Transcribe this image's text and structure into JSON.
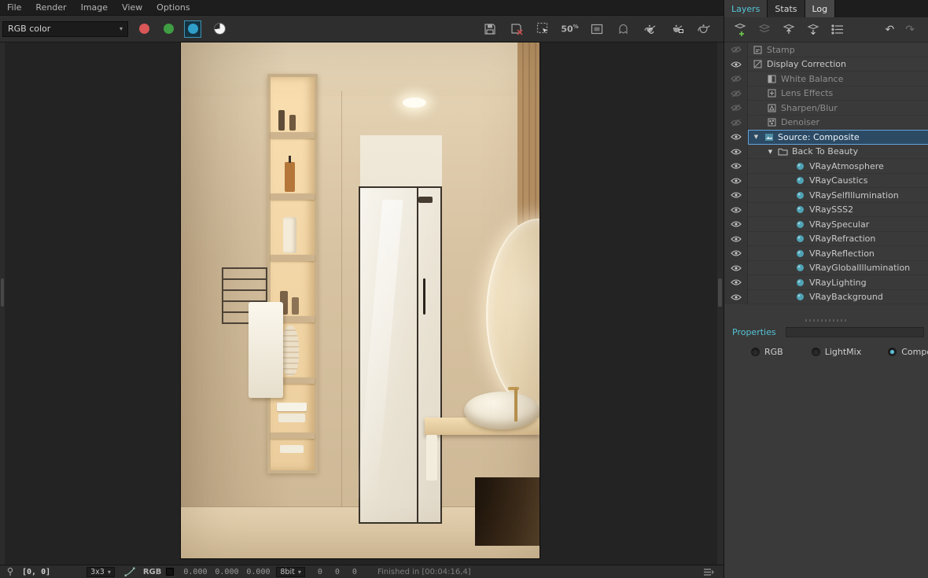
{
  "colors": {
    "accent": "#56c5d8",
    "selection": "#68a5da",
    "red_channel": "#d95757",
    "green_channel": "#43a047",
    "blue_channel": "#2f9fc9"
  },
  "glyphs": {
    "caret": "▾",
    "expand": "▼",
    "undo": "↶",
    "redo": "↷"
  },
  "menubar": {
    "items": [
      "File",
      "Render",
      "Image",
      "View",
      "Options"
    ]
  },
  "toolbar": {
    "channel_dropdown": "RGB color",
    "zoom_label": "50",
    "zoom_pct": "%"
  },
  "panel": {
    "tabs": [
      {
        "label": "Layers"
      },
      {
        "label": "Stats"
      },
      {
        "label": "Log"
      }
    ],
    "layers": [
      {
        "label": "Stamp"
      },
      {
        "label": "Display Correction"
      },
      {
        "label": "White Balance"
      },
      {
        "label": "Lens Effects"
      },
      {
        "label": "Sharpen/Blur"
      },
      {
        "label": "Denoiser"
      },
      {
        "label": "Source: Composite"
      },
      {
        "label": "Back To Beauty"
      },
      {
        "label": "VRayAtmosphere"
      },
      {
        "label": "VRayCaustics"
      },
      {
        "label": "VRaySelfIllumination"
      },
      {
        "label": "VRaySSS2"
      },
      {
        "label": "VRaySpecular"
      },
      {
        "label": "VRayRefraction"
      },
      {
        "label": "VRayReflection"
      },
      {
        "label": "VRayGlobalIllumination"
      },
      {
        "label": "VRayLighting"
      },
      {
        "label": "VRayBackground"
      }
    ],
    "properties": {
      "title": "Properties",
      "options": [
        {
          "label": "RGB"
        },
        {
          "label": "LightMix"
        },
        {
          "label": "Composite"
        }
      ],
      "selected": "Composite"
    }
  },
  "statusbar": {
    "coords": "[0, 0]",
    "kernel": "3x3",
    "channel": "RGB",
    "values": [
      "0.000",
      "0.000",
      "0.000"
    ],
    "depth": "8bit",
    "ints": [
      "0",
      "0",
      "0"
    ],
    "message": "Finished in [00:04:16,4]"
  }
}
